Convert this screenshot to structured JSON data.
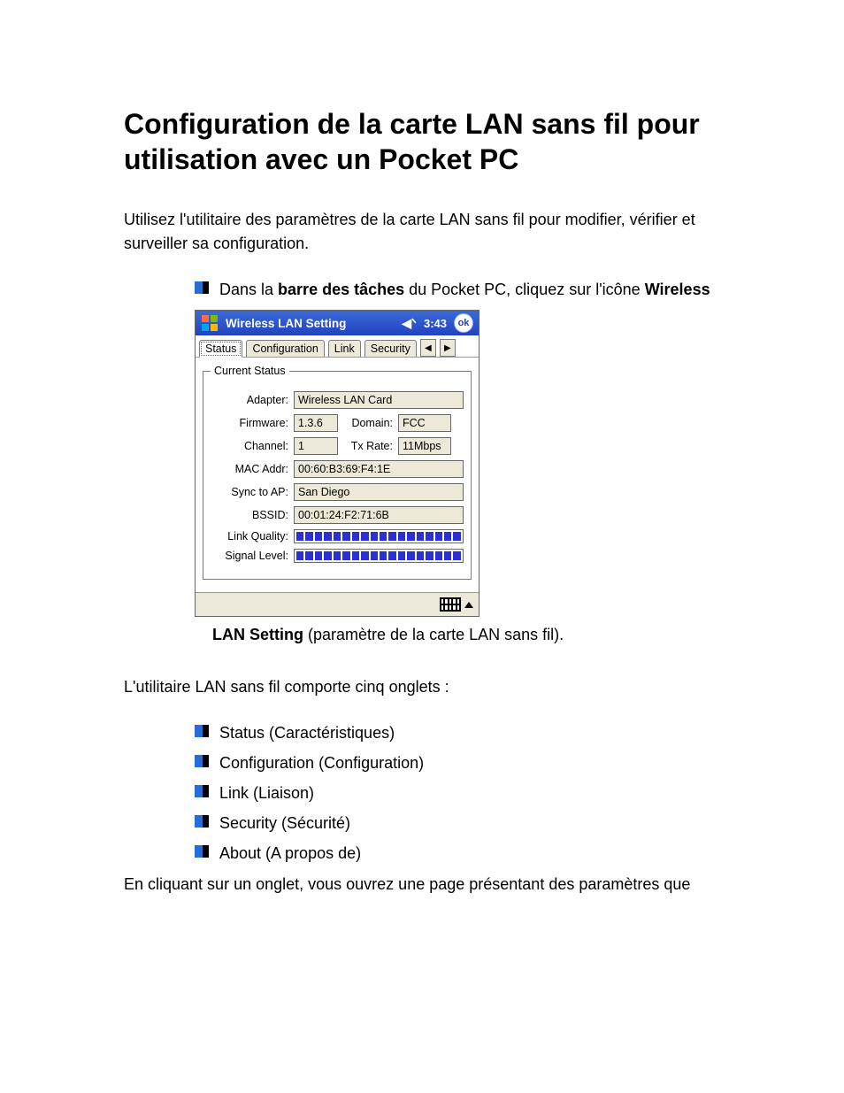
{
  "title": "Configuration de la carte LAN sans fil pour utilisation avec un Pocket PC",
  "intro": "Utilisez l'utilitaire des paramètres de la carte LAN sans fil pour modifier, vérifier et surveiller sa configuration.",
  "step_prefix": "Dans la ",
  "step_bold1": "barre des tâches",
  "step_mid": " du Pocket PC, cliquez sur l'icône ",
  "step_bold2": "Wireless",
  "caption_bold": "LAN Setting",
  "caption_rest": " (paramètre de la carte LAN sans fil).",
  "tabs_intro": "L'utilitaire LAN sans fil comporte cinq onglets :",
  "tabs_list": [
    "Status (Caractéristiques)",
    "Configuration (Configuration)",
    "Link (Liaison)",
    "Security (Sécurité)",
    "About (A propos de)"
  ],
  "closing": "En cliquant sur un onglet, vous ouvrez une page présentant des paramètres que",
  "ppc": {
    "app_title": "Wireless LAN Setting",
    "time": "3:43",
    "ok": "ok",
    "tabs": [
      "Status",
      "Configuration",
      "Link",
      "Security"
    ],
    "active_tab_index": 0,
    "groupbox": "Current Status",
    "fields": {
      "adapter_label": "Adapter:",
      "adapter_value": "Wireless LAN Card",
      "firmware_label": "Firmware:",
      "firmware_value": "1.3.6",
      "domain_label": "Domain:",
      "domain_value": "FCC",
      "channel_label": "Channel:",
      "channel_value": "1",
      "txrate_label": "Tx Rate:",
      "txrate_value": "11Mbps",
      "mac_label": "MAC Addr:",
      "mac_value": "00:60:B3:69:F4:1E",
      "sync_label": "Sync to AP:",
      "sync_value": "San Diego",
      "bssid_label": "BSSID:",
      "bssid_value": "00:01:24:F2:71:6B",
      "linkq_label": "Link Quality:",
      "signal_label": "Signal Level:"
    },
    "link_quality_segments": 18,
    "signal_level_segments": 18
  }
}
